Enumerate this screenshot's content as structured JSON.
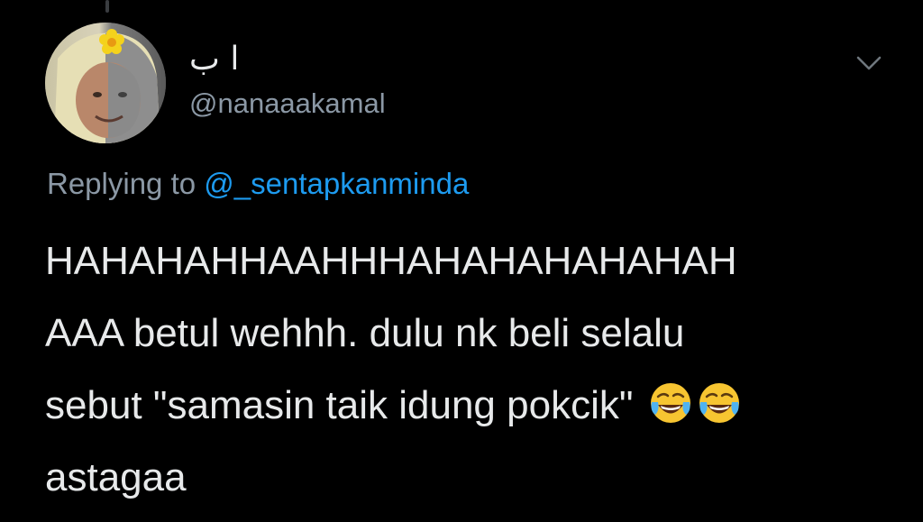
{
  "tweet": {
    "author": {
      "display_name": "ا ب",
      "handle": "@nanaaakamal"
    },
    "replying_to": {
      "prefix": "Replying to",
      "mention": "@_sentapkanminda"
    },
    "text_lines": [
      "HAHAHAHHAAHHHAHAHAHAHAHAH",
      "AAA betul wehhh. dulu nk beli selalu",
      "sebut \"samasin taik idung pokcik\"",
      "astagaa"
    ],
    "emojis": [
      "face-with-tears-of-joy",
      "face-with-tears-of-joy"
    ]
  },
  "icons": {
    "more_options": "chevron-down-icon"
  },
  "colors": {
    "background": "#000000",
    "text_primary": "#e7e9ea",
    "text_secondary": "#8b98a5",
    "link": "#1d9bf0"
  }
}
